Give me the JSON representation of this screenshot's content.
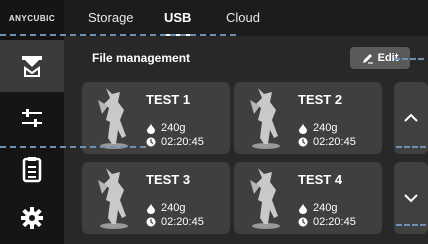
{
  "sidebar": {
    "logo": "ANYCUBIC",
    "items": [
      {
        "icon": "printer-icon",
        "active": true
      },
      {
        "icon": "sliders-icon",
        "active": false
      },
      {
        "icon": "file-list-icon",
        "active": false
      },
      {
        "icon": "gear-icon",
        "active": false
      }
    ]
  },
  "tabs": [
    {
      "label": "Storage",
      "active": false
    },
    {
      "label": "USB",
      "active": true
    },
    {
      "label": "Cloud",
      "active": false
    }
  ],
  "section": {
    "title": "File management",
    "edit_label": "Edit"
  },
  "files": [
    {
      "name": "TEST 1",
      "weight": "240g",
      "time": "02:20:45"
    },
    {
      "name": "TEST 2",
      "weight": "240g",
      "time": "02:20:45"
    },
    {
      "name": "TEST 3",
      "weight": "240g",
      "time": "02:20:45"
    },
    {
      "name": "TEST 4",
      "weight": "240g",
      "time": "02:20:45"
    }
  ],
  "colors": {
    "sidebar_bg": "#151515",
    "active_nav": "#3b3b3b",
    "card_bg": "#3f3f3f",
    "annotation_line": "#6f8fb4"
  }
}
